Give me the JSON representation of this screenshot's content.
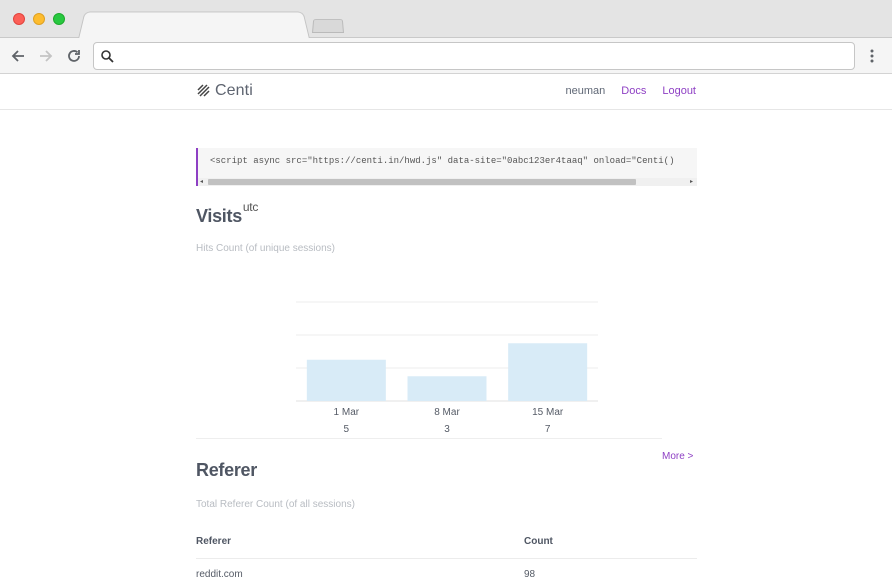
{
  "browser": {
    "address_value": "",
    "address_placeholder": ""
  },
  "site": {
    "logo_text": "Centi",
    "nav": {
      "user": "neuman",
      "docs": "Docs",
      "logout": "Logout"
    }
  },
  "embed_code": "<script async src=\"https://centi.in/hwd.js\" data-site=\"0abc123er4taaq\" onload=\"Centi()",
  "visits": {
    "title": "Visits",
    "title_sup": "utc",
    "subtitle": "Hits Count (of unique sessions)"
  },
  "chart_data": {
    "type": "bar",
    "categories": [
      "1 Mar",
      "8 Mar",
      "15 Mar"
    ],
    "values": [
      5,
      3,
      7
    ],
    "ylim": [
      0,
      12
    ],
    "grid": true,
    "color": "#d8ebf7"
  },
  "more_link": "More >",
  "referer": {
    "title": "Referer",
    "subtitle": "Total Referer Count (of all sessions)",
    "columns": [
      "Referer",
      "Count"
    ],
    "rows": [
      {
        "referer": "reddit.com",
        "count": "98"
      }
    ]
  },
  "colors": {
    "accent": "#8e3fc4",
    "bar": "#d8ebf7"
  }
}
